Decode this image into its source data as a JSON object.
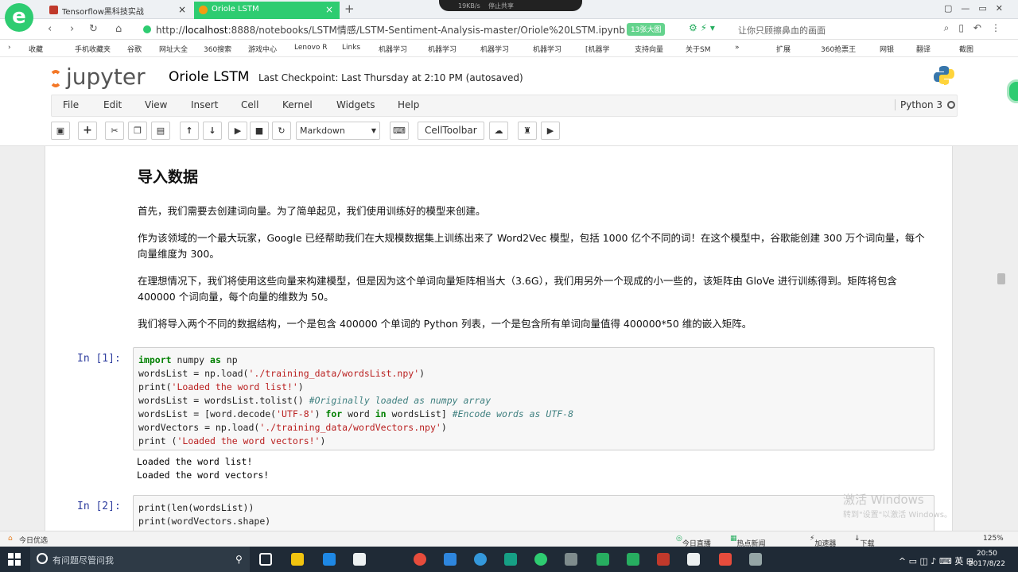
{
  "browser": {
    "tabs": [
      {
        "label": "Tensorflow黑科技实战",
        "active": false
      },
      {
        "label": "Oriole LSTM",
        "active": true
      }
    ],
    "notch_speed": "19KB/s",
    "notch_share": "停止共享",
    "url_prefix": "http://",
    "url_host": "localhost",
    "url_path": ":8888/notebooks/LSTM情感/LSTM-Sentiment-Analysis-master/Oriole%20LSTM.ipynb",
    "url_badge": "13张大图",
    "search_hint": "让你只顾擦鼻血的画面",
    "bookmarks": [
      "收藏",
      "手机收藏夹",
      "谷歌",
      "网址大全",
      "360搜索",
      "游戏中心",
      "Lenovo R",
      "Links",
      "机器学习",
      "机器学习",
      "机器学习",
      "机器学习",
      "[机器学",
      "支持向量",
      "关于SM",
      "»",
      "扩展",
      "360抢票王",
      "网银",
      "翻译",
      "截图"
    ]
  },
  "notebook": {
    "logo_text": "jupyter",
    "title": "Oriole LSTM",
    "checkpoint": "Last Checkpoint: Last Thursday at 2:10 PM (autosaved)",
    "menu": [
      "File",
      "Edit",
      "View",
      "Insert",
      "Cell",
      "Kernel",
      "Widgets",
      "Help"
    ],
    "kernel": "Python 3",
    "toolbar": {
      "cell_type": "Markdown",
      "celltoolbar": "CellToolbar"
    },
    "markdown": {
      "heading": "导入数据",
      "p1": "首先，我们需要去创建词向量。为了简单起见，我们使用训练好的模型来创建。",
      "p2": "作为该领域的一个最大玩家，Google 已经帮助我们在大规模数据集上训练出来了 Word2Vec 模型，包括 1000 亿个不同的词！在这个模型中，谷歌能创建 300 万个词向量，每个向量维度为 300。",
      "p3": "在理想情况下，我们将使用这些向量来构建模型，但是因为这个单词向量矩阵相当大（3.6G），我们用另外一个现成的小一些的，该矩阵由 GloVe 进行训练得到。矩阵将包含 400000 个词向量，每个向量的维数为 50。",
      "p4": "我们将导入两个不同的数据结构，一个是包含 400000 个单词的 Python 列表，一个是包含所有单词向量值得 400000*50 维的嵌入矩阵。"
    },
    "cell1": {
      "prompt": "In [1]:",
      "output": [
        "Loaded the word list!",
        "Loaded the word vectors!"
      ]
    },
    "cell2": {
      "prompt": "In [2]:",
      "lines": [
        "print(len(wordsList))",
        "print(wordVectors.shape)"
      ]
    }
  },
  "overlay": {
    "watermark_title": "激活 Windows",
    "watermark_sub": "转到\"设置\"以激活 Windows。"
  },
  "statusbar": {
    "left": "今日优选",
    "items": [
      "今日直播",
      "热点新闻",
      "加速器",
      "下载",
      "125%"
    ]
  },
  "taskbar": {
    "search_placeholder": "有问题尽管问我",
    "lang": "英",
    "time": "20:50",
    "date": "2017/8/22"
  }
}
